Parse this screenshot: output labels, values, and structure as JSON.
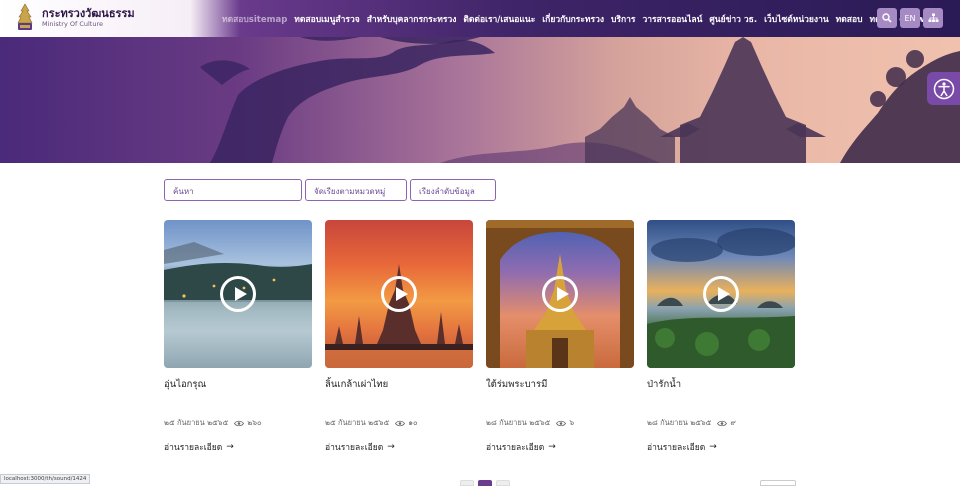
{
  "header": {
    "title": "กระทรวงวัฒนธรรม",
    "subtitle": "Ministry Of Culture",
    "nav": [
      {
        "label": "ทดสอบsitemap"
      },
      {
        "label": "ทดสอบเมนูสำรวจ"
      },
      {
        "label": "สำหรับบุคลากรกระทรวง"
      },
      {
        "label": "ติดต่อเรา/เสนอแนะ"
      },
      {
        "label": "เกี่ยวกับกระทรวง"
      },
      {
        "label": "บริการ"
      },
      {
        "label": "วารสารออนไลน์"
      },
      {
        "label": "ศูนย์ข่าว วธ."
      },
      {
        "label": "เว็บไซต์หน่วยงาน"
      },
      {
        "label": "ทดสอบ"
      },
      {
        "label": "ทดสอบ enew"
      }
    ],
    "lang_label": "EN",
    "search_icon": "search-icon",
    "sitemap_icon": "sitemap-icon"
  },
  "filters": {
    "search_placeholder": "ค้นหา",
    "category_label": "จัดเรียงตามหมวดหมู่",
    "sort_label": "เรียงลำดับข้อมูล"
  },
  "cards": [
    {
      "title": "อุ่นไอกรุณ",
      "date": "๒๕ กันยายน ๒๕๖๕",
      "views": "๒๖๐",
      "more": "อ่านรายละเอียด"
    },
    {
      "title": "ลิ้นเกล้าเผ่าไทย",
      "date": "๒๕ กันยายน ๒๕๖๕",
      "views": "๑๐",
      "more": "อ่านรายละเอียด"
    },
    {
      "title": "ใต้ร่มพระบารมี",
      "date": "๒๘ กันยายน ๒๕๖๕",
      "views": "๖",
      "more": "อ่านรายละเอียด"
    },
    {
      "title": "ป่ารักน้ำ",
      "date": "๒๘ กันยายน ๒๕๖๕",
      "views": "๙",
      "more": "อ่านรายละเอียด"
    }
  ],
  "statusbar": {
    "url": "localhost:3000/th/sound/1424"
  },
  "colors": {
    "brand": "#6a3b8f",
    "accent": "#8d64b3"
  }
}
